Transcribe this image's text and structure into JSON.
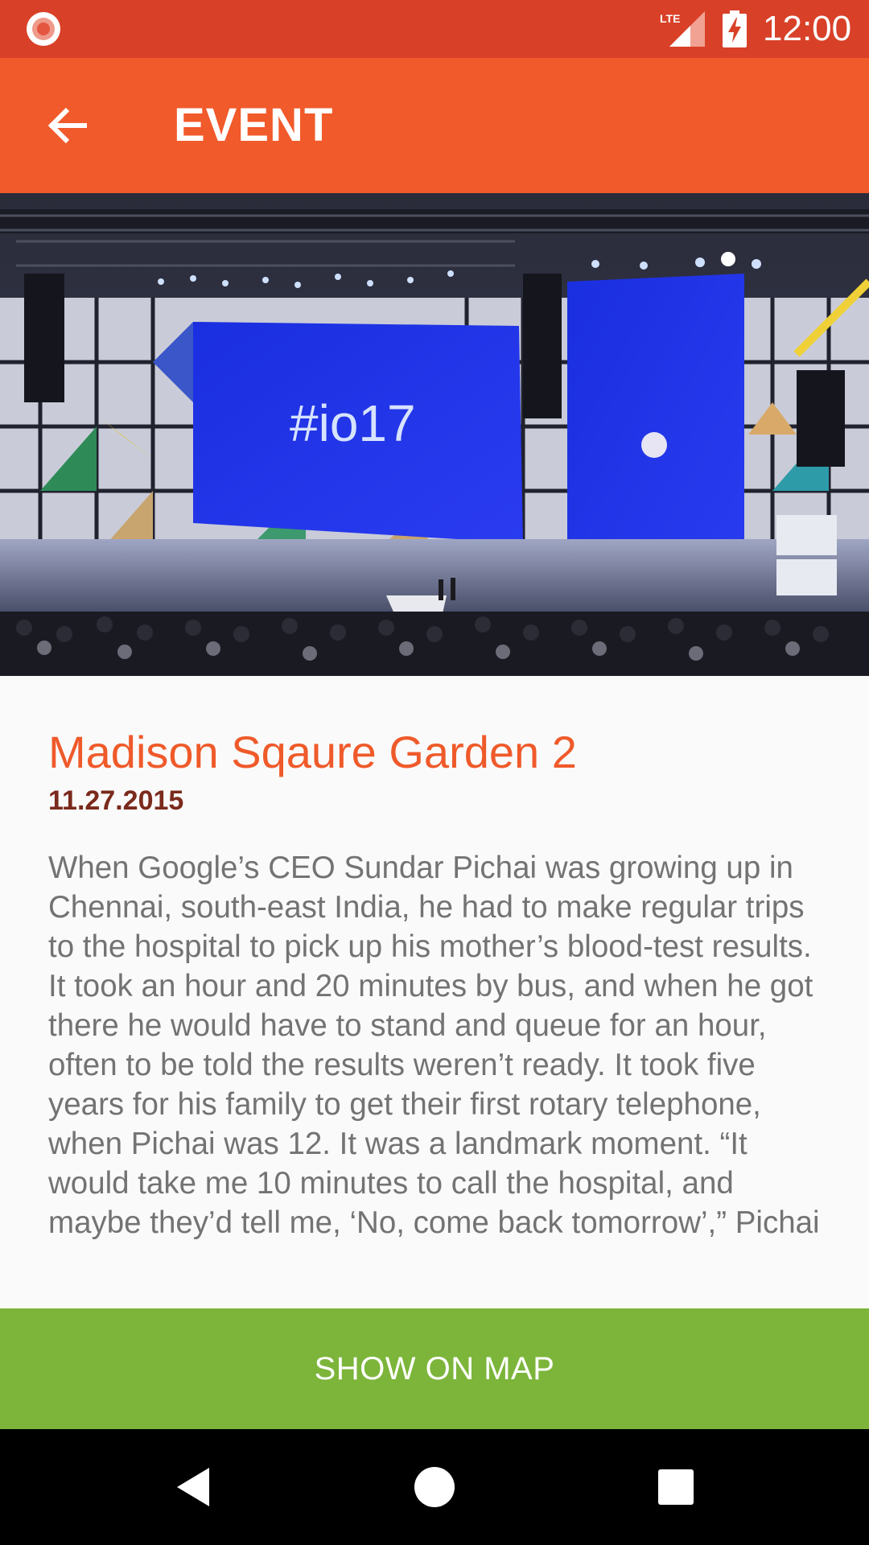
{
  "status_bar": {
    "time": "12:00",
    "network_label": "LTE",
    "icons": [
      "screen-record-icon",
      "lte-signal-icon",
      "battery-charging-icon"
    ]
  },
  "app_bar": {
    "title": "EVENT",
    "back_icon": "arrow-back-icon"
  },
  "hero_image": {
    "stage_text": "#io17"
  },
  "event": {
    "title": "Madison Sqaure Garden 2",
    "date": "11.27.2015",
    "description": "When Google’s CEO Sundar Pichai was growing up in Chennai, south-east India, he had to make regular trips to the hospital to pick up his mother’s blood-test results. It took an hour and 20 minutes by bus, and when he got there he would have to stand and queue for an hour, often to be told the results weren’t ready. It took five years for his family to get their first rotary telephone, when Pichai was 12. It was a landmark moment. “It would take me 10 minutes to call the hospital, and maybe they’d tell me, ‘No, come back tomorrow’,” Pichai says."
  },
  "actions": {
    "show_on_map": "SHOW ON MAP"
  },
  "nav_bar": {
    "icons": [
      "nav-back-icon",
      "nav-home-icon",
      "nav-recents-icon"
    ]
  },
  "colors": {
    "status_bar": "#d84128",
    "app_bar": "#f15a2a",
    "title_accent": "#ef5a2a",
    "date": "#7a2a1c",
    "body_text": "#737373",
    "map_button": "#7cb53a"
  }
}
